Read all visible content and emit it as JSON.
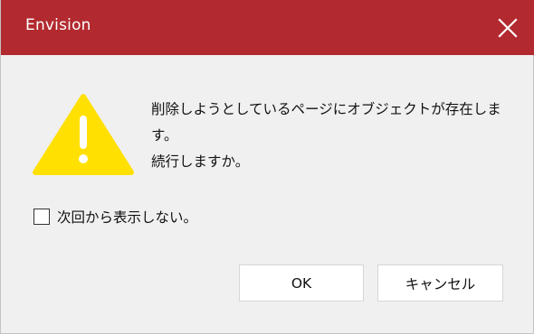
{
  "window": {
    "title": "Envision",
    "titlebar_color": "#b22a2f"
  },
  "icons": {
    "warning": "warning-triangle-icon",
    "close": "close-icon"
  },
  "colors": {
    "warning_yellow": "#ffe000"
  },
  "message": {
    "lines": [
      "削除しようとしているページにオブジェクトが存在しま",
      "す。",
      "続行しますか。"
    ]
  },
  "checkbox": {
    "label": "次回から表示しない。",
    "checked": false
  },
  "buttons": {
    "ok": "OK",
    "cancel": "キャンセル"
  }
}
